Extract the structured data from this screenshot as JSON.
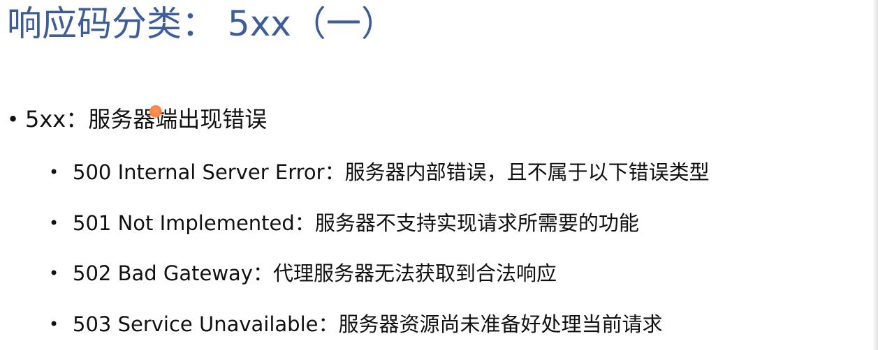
{
  "slide": {
    "title": "响应码分类： 5xx（一）",
    "main_bullet": {
      "text": "5xx：服务器端出现错误",
      "bullet": "•"
    },
    "sub_bullets": [
      {
        "code": "500 Internal Server Error",
        "separator": "：",
        "description": "服务器内部错误，且不属于以下错误类型",
        "bullet": "•"
      },
      {
        "code": "501 Not Implemented",
        "separator": "：",
        "description": "服务器不支持实现请求所需要的功能",
        "bullet": "•"
      },
      {
        "code": "502 Bad Gateway",
        "separator": "：",
        "description": "代理服务器无法获取到合法响应",
        "bullet": "•"
      },
      {
        "code": "503 Service Unavailable",
        "separator": "：",
        "description": "服务器资源尚未准备好处理当前请求",
        "bullet": "•"
      }
    ],
    "colors": {
      "title": "#3c5d98",
      "body": "#111111",
      "cursor": "#ff7f3f"
    }
  }
}
